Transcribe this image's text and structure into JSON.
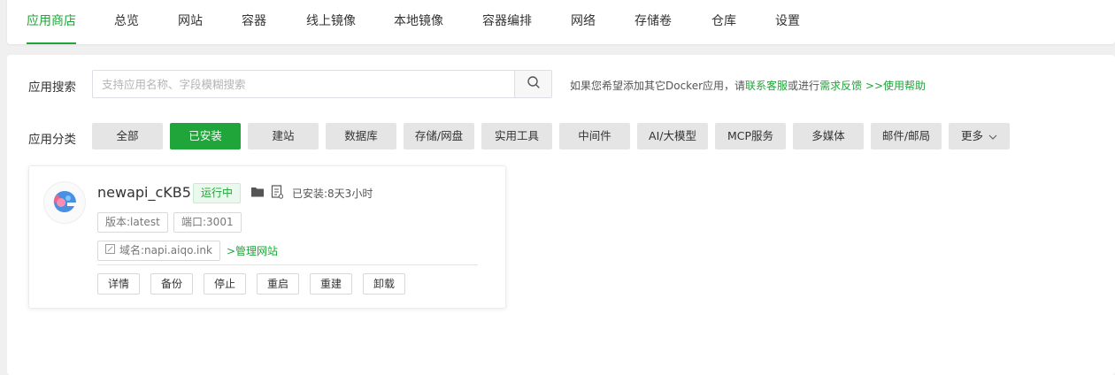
{
  "tabs": [
    {
      "label": "应用商店",
      "active": true
    },
    {
      "label": "总览"
    },
    {
      "label": "网站"
    },
    {
      "label": "容器"
    },
    {
      "label": "线上镜像"
    },
    {
      "label": "本地镜像"
    },
    {
      "label": "容器编排"
    },
    {
      "label": "网络"
    },
    {
      "label": "存储卷"
    },
    {
      "label": "仓库"
    },
    {
      "label": "设置"
    }
  ],
  "search": {
    "label": "应用搜索",
    "placeholder": "支持应用名称、字段模糊搜索",
    "value": "",
    "button_icon": "search-icon"
  },
  "hint": {
    "prefix": "如果您希望添加其它Docker应用，请",
    "link1": "联系客服",
    "middle": "或进行",
    "link2": "需求反馈",
    "arrow": " >>",
    "link3": "使用帮助"
  },
  "categories": {
    "label": "应用分类",
    "items": [
      {
        "label": "全部"
      },
      {
        "label": "已安装",
        "active": true
      },
      {
        "label": "建站"
      },
      {
        "label": "数据库"
      },
      {
        "label": "存储/网盘"
      },
      {
        "label": "实用工具"
      },
      {
        "label": "中间件"
      },
      {
        "label": "AI/大模型"
      },
      {
        "label": "MCP服务"
      },
      {
        "label": "多媒体"
      },
      {
        "label": "邮件/邮局"
      }
    ],
    "more_label": "更多"
  },
  "app": {
    "name": "newapi_cKB5",
    "status": "运行中",
    "installed": "已安装:8天3小时",
    "version": "版本:latest",
    "port": "端口:3001",
    "domain": "域名:napi.aiqo.ink",
    "manage_link": ">管理网站",
    "actions": [
      "详情",
      "备份",
      "停止",
      "重启",
      "重建",
      "卸载"
    ]
  },
  "colors": {
    "accent": "#20a53a",
    "badge_bg": "#eaf8ee",
    "category_bg": "#e5e5e5"
  }
}
